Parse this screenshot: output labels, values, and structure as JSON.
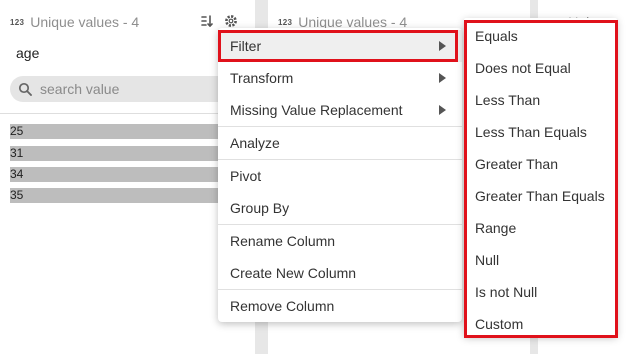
{
  "columns": [
    {
      "type_badge": "123",
      "header": "Unique values - 4",
      "name": "age",
      "search_placeholder": "search value",
      "values": [
        "25",
        "31",
        "34",
        "35"
      ]
    },
    {
      "type_badge": "123",
      "header": "Unique values - 4"
    },
    {
      "type_badge": "123",
      "header": "Uniq"
    }
  ],
  "menu": {
    "items": [
      {
        "label": "Filter",
        "submenu": true,
        "highlighted": true
      },
      {
        "label": "Transform",
        "submenu": true
      },
      {
        "label": "Missing Value Replacement",
        "submenu": true
      },
      {
        "label": "Analyze"
      },
      {
        "label": "Pivot"
      },
      {
        "label": "Group By"
      },
      {
        "label": "Rename Column"
      },
      {
        "label": "Create New Column"
      },
      {
        "label": "Remove Column"
      }
    ]
  },
  "filter_submenu": {
    "items": [
      "Equals",
      "Does not Equal",
      "Less Than",
      "Less Than Equals",
      "Greater Than",
      "Greater Than Equals",
      "Range",
      "Null",
      "Is not Null",
      "Custom"
    ]
  },
  "colors": {
    "highlight_box": "#e0111b",
    "value_bar": "#bdbdbd",
    "menu_hover": "#efefef"
  },
  "icons": [
    "sort-icon",
    "gear-icon",
    "search-icon",
    "chevron-right-icon"
  ]
}
